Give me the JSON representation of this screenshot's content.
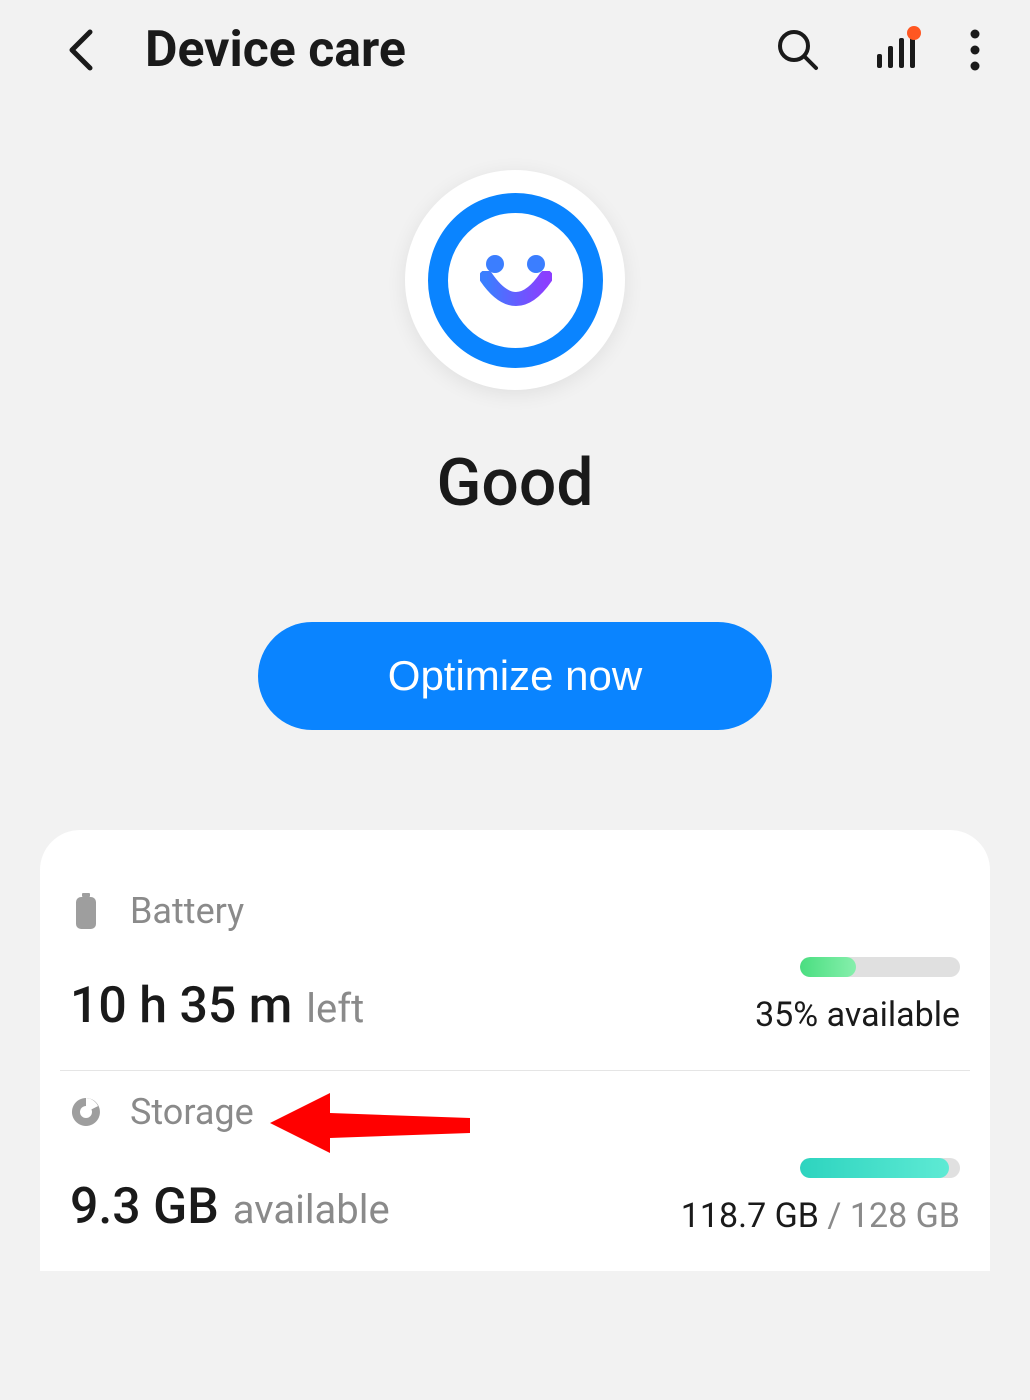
{
  "header": {
    "title": "Device care"
  },
  "status": {
    "label": "Good",
    "optimize_button": "Optimize now"
  },
  "battery": {
    "label": "Battery",
    "time_value": "10 h 35 m",
    "time_suffix": "left",
    "availability": "35% available",
    "percent": 35
  },
  "storage": {
    "label": "Storage",
    "available_value": "9.3 GB",
    "available_suffix": "available",
    "used": "118.7 GB",
    "separator": " / ",
    "total": "128 GB",
    "percent": 93
  },
  "colors": {
    "accent": "#0a84ff",
    "battery_bar": "#4ade80",
    "storage_bar": "#2dd4bf",
    "arrow": "#ff0000"
  }
}
